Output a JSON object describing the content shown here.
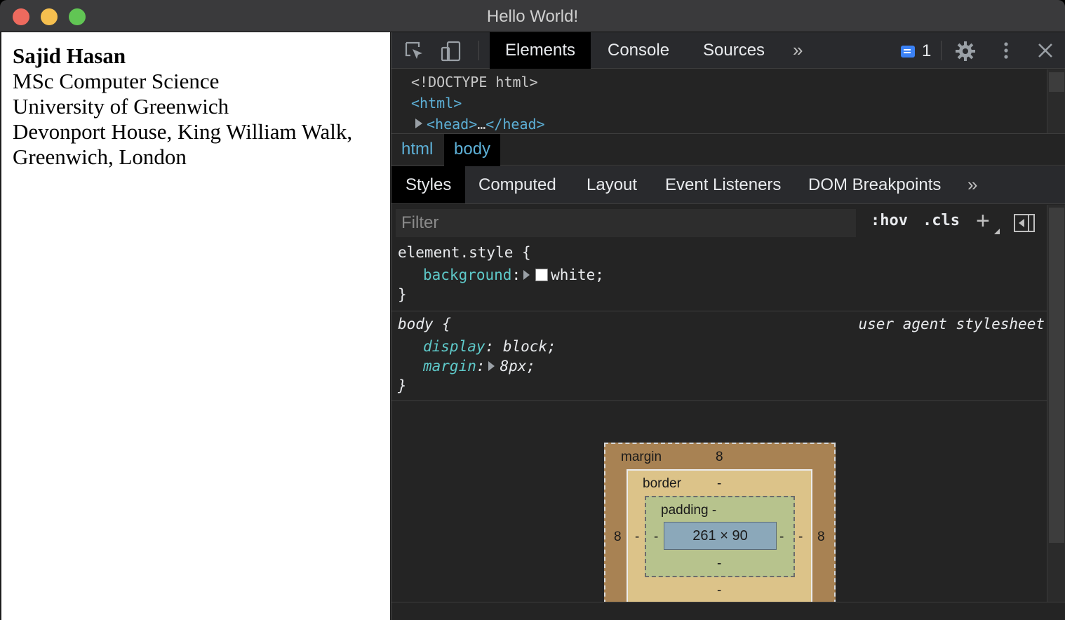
{
  "window": {
    "title": "Hello World!"
  },
  "page": {
    "name": "Sajid Hasan",
    "lines": [
      "MSc Computer Science",
      "University of Greenwich",
      "Devonport House, King William Walk,",
      "Greenwich, London"
    ]
  },
  "devtools": {
    "toolbar": {
      "tabs": [
        "Elements",
        "Console",
        "Sources"
      ],
      "active_tab": "Elements",
      "more": "»",
      "message_count": "1",
      "icons": [
        "inspect-element-icon",
        "device-toolbar-icon",
        "message-icon",
        "gear-icon",
        "kebab-menu-icon",
        "close-icon"
      ]
    },
    "dom_tree": {
      "doctype": "<!DOCTYPE html>",
      "html_open": "<html>",
      "head_open": "<head>",
      "head_ellipsis": "…",
      "head_close": "</head>"
    },
    "breadcrumbs": [
      "html",
      "body"
    ],
    "sub_tabs": [
      "Styles",
      "Computed",
      "Layout",
      "Event Listeners",
      "DOM Breakpoints"
    ],
    "sub_more": "»",
    "filter": {
      "placeholder": "Filter",
      "hov": ":hov",
      "cls": ".cls",
      "plus": "+"
    },
    "rules": {
      "element_style": {
        "selector": "element.style {",
        "prop": "background",
        "value": "white;",
        "close": "}"
      },
      "body": {
        "selector": "body {",
        "source": "user agent stylesheet",
        "prop1": "display",
        "value1": "block;",
        "prop2": "margin",
        "value2": "8px;",
        "close": "}"
      }
    },
    "box_model": {
      "margin_label": "margin",
      "margin_top": "8",
      "margin_left": "8",
      "margin_right": "8",
      "border_label": "border",
      "border_top": "-",
      "border_left": "-",
      "border_right": "-",
      "border_bottom": "-",
      "padding_label": "padding -",
      "padding_left": "-",
      "padding_right": "-",
      "padding_bottom": "-",
      "content": "261 × 90"
    }
  }
}
